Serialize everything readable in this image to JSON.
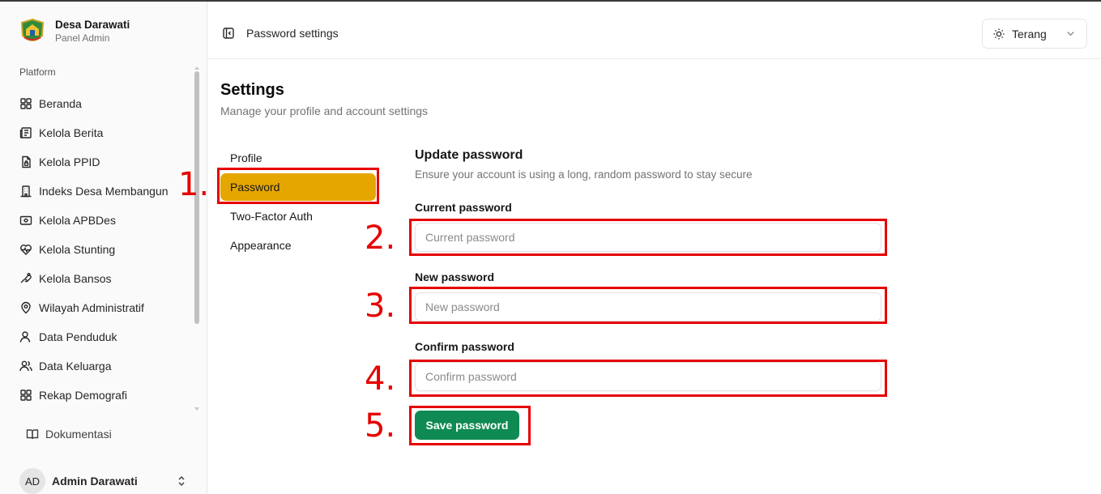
{
  "brand": {
    "title": "Desa Darawati",
    "subtitle": "Panel Admin"
  },
  "sidebar": {
    "group_label": "Platform",
    "items": [
      {
        "label": "Beranda",
        "icon": "layout-grid-icon"
      },
      {
        "label": "Kelola Berita",
        "icon": "newspaper-icon"
      },
      {
        "label": "Kelola PPID",
        "icon": "file-lock-icon"
      },
      {
        "label": "Indeks Desa Membangun",
        "icon": "building-icon"
      },
      {
        "label": "Kelola APBDes",
        "icon": "wallet-icon"
      },
      {
        "label": "Kelola Stunting",
        "icon": "heart-pulse-icon"
      },
      {
        "label": "Kelola Bansos",
        "icon": "hand-coins-icon"
      },
      {
        "label": "Wilayah Administratif",
        "icon": "map-pin-icon"
      },
      {
        "label": "Data Penduduk",
        "icon": "user-icon"
      },
      {
        "label": "Data Keluarga",
        "icon": "users-icon"
      },
      {
        "label": "Rekap Demografi",
        "icon": "layout-grid-icon"
      }
    ],
    "docs_label": "Dokumentasi",
    "user": {
      "initials": "AD",
      "name": "Admin Darawati"
    }
  },
  "header": {
    "breadcrumb": "Password settings",
    "theme": "Terang"
  },
  "page": {
    "title": "Settings",
    "subtitle": "Manage your profile and account settings"
  },
  "settings_nav": [
    "Profile",
    "Password",
    "Two-Factor Auth",
    "Appearance"
  ],
  "settings_nav_active": "Password",
  "form": {
    "title": "Update password",
    "subtitle": "Ensure your account is using a long, random password to stay secure",
    "current_label": "Current password",
    "current_placeholder": "Current password",
    "new_label": "New password",
    "new_placeholder": "New password",
    "confirm_label": "Confirm password",
    "confirm_placeholder": "Confirm password",
    "save_label": "Save password"
  },
  "annotations": [
    "1.",
    "2.",
    "3.",
    "4.",
    "5."
  ],
  "colors": {
    "accent_active": "#e6a600",
    "save_button": "#0f8a52",
    "annotation": "#e60000"
  }
}
